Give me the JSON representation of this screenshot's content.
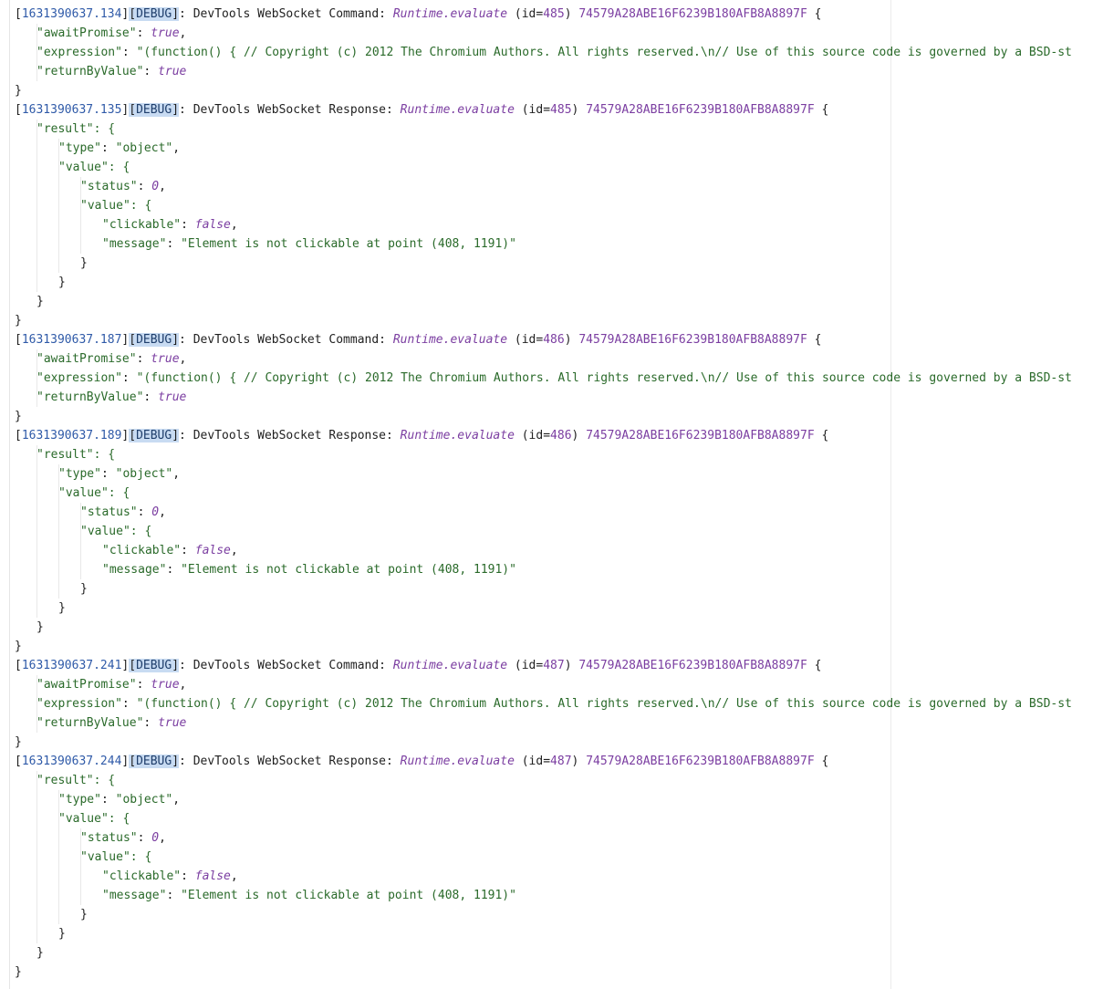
{
  "log": {
    "entries": [
      {
        "kind": "command",
        "timestamp": "1631390637.134",
        "level": "DEBUG",
        "text": "DevTools WebSocket Command:",
        "method": "Runtime.evaluate",
        "id_label": "(id=",
        "id": "485",
        "id_close": ")",
        "target": "74579A28ABE16F6239B180AFB8A8897F",
        "open_brace": "{",
        "close_brace": "}",
        "params": [
          {
            "key": "\"awaitPromise\"",
            "sep": ": ",
            "value": "true",
            "trail": ","
          },
          {
            "key": "\"expression\"",
            "sep": ": ",
            "value": "\"(function() { // Copyright (c) 2012 The Chromium Authors. All rights reserved.\\n// Use of this source code is governed by a BSD-st",
            "trail": ""
          },
          {
            "key": "\"returnByValue\"",
            "sep": ": ",
            "value": "true",
            "trail": ""
          }
        ]
      },
      {
        "kind": "response",
        "timestamp": "1631390637.135",
        "level": "DEBUG",
        "text": "DevTools WebSocket Response:",
        "method": "Runtime.evaluate",
        "id_label": "(id=",
        "id": "485",
        "id_close": ")",
        "target": "74579A28ABE16F6239B180AFB8A8897F",
        "open_brace": "{",
        "close_brace": "}",
        "result_key": "\"result\": {",
        "type_key": "\"type\"",
        "type_value": "\"object\"",
        "value_key": "\"value\": {",
        "status_key": "\"status\"",
        "status_value": "0",
        "inner_value_key": "\"value\": {",
        "clickable_key": "\"clickable\"",
        "clickable_value": "false",
        "message_key": "\"message\"",
        "message_value": "\"Element is not clickable at point (408, 1191)\""
      },
      {
        "kind": "command",
        "timestamp": "1631390637.187",
        "level": "DEBUG",
        "text": "DevTools WebSocket Command:",
        "method": "Runtime.evaluate",
        "id_label": "(id=",
        "id": "486",
        "id_close": ")",
        "target": "74579A28ABE16F6239B180AFB8A8897F",
        "open_brace": "{",
        "close_brace": "}",
        "params": [
          {
            "key": "\"awaitPromise\"",
            "sep": ": ",
            "value": "true",
            "trail": ","
          },
          {
            "key": "\"expression\"",
            "sep": ": ",
            "value": "\"(function() { // Copyright (c) 2012 The Chromium Authors. All rights reserved.\\n// Use of this source code is governed by a BSD-st",
            "trail": ""
          },
          {
            "key": "\"returnByValue\"",
            "sep": ": ",
            "value": "true",
            "trail": ""
          }
        ]
      },
      {
        "kind": "response",
        "timestamp": "1631390637.189",
        "level": "DEBUG",
        "text": "DevTools WebSocket Response:",
        "method": "Runtime.evaluate",
        "id_label": "(id=",
        "id": "486",
        "id_close": ")",
        "target": "74579A28ABE16F6239B180AFB8A8897F",
        "open_brace": "{",
        "close_brace": "}",
        "result_key": "\"result\": {",
        "type_key": "\"type\"",
        "type_value": "\"object\"",
        "value_key": "\"value\": {",
        "status_key": "\"status\"",
        "status_value": "0",
        "inner_value_key": "\"value\": {",
        "clickable_key": "\"clickable\"",
        "clickable_value": "false",
        "message_key": "\"message\"",
        "message_value": "\"Element is not clickable at point (408, 1191)\""
      },
      {
        "kind": "command",
        "timestamp": "1631390637.241",
        "level": "DEBUG",
        "text": "DevTools WebSocket Command:",
        "method": "Runtime.evaluate",
        "id_label": "(id=",
        "id": "487",
        "id_close": ")",
        "target": "74579A28ABE16F6239B180AFB8A8897F",
        "open_brace": "{",
        "close_brace": "}",
        "params": [
          {
            "key": "\"awaitPromise\"",
            "sep": ": ",
            "value": "true",
            "trail": ","
          },
          {
            "key": "\"expression\"",
            "sep": ": ",
            "value": "\"(function() { // Copyright (c) 2012 The Chromium Authors. All rights reserved.\\n// Use of this source code is governed by a BSD-st",
            "trail": ""
          },
          {
            "key": "\"returnByValue\"",
            "sep": ": ",
            "value": "true",
            "trail": ""
          }
        ]
      },
      {
        "kind": "response",
        "timestamp": "1631390637.244",
        "level": "DEBUG",
        "text": "DevTools WebSocket Response:",
        "method": "Runtime.evaluate",
        "id_label": "(id=",
        "id": "487",
        "id_close": ")",
        "target": "74579A28ABE16F6239B180AFB8A8897F",
        "open_brace": "{",
        "close_brace": "}",
        "result_key": "\"result\": {",
        "type_key": "\"type\"",
        "type_value": "\"object\"",
        "value_key": "\"value\": {",
        "status_key": "\"status\"",
        "status_value": "0",
        "inner_value_key": "\"value\": {",
        "clickable_key": "\"clickable\"",
        "clickable_value": "false",
        "message_key": "\"message\"",
        "message_value": "\"Element is not clickable at point (408, 1191)\""
      }
    ]
  },
  "colors": {
    "timestamp": "#2f5aa8",
    "debug_badge_bg": "#c8dbf2",
    "method": "#7b3ea1",
    "key": "#2a6a2a",
    "string": "#2a6a2a",
    "literal": "#7b3ea1",
    "text": "#1f1f1f",
    "background": "#ffffff"
  }
}
